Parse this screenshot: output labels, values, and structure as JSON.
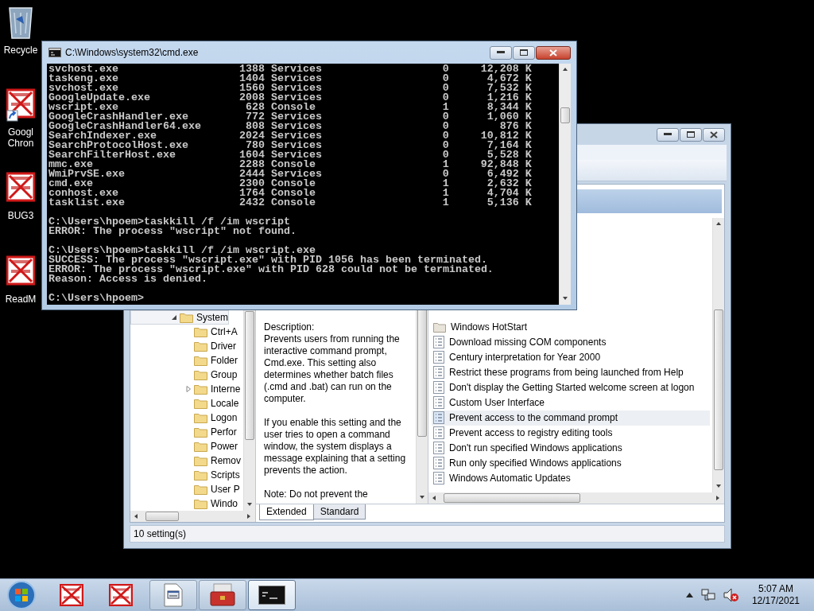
{
  "desktop_icons": [
    {
      "kind": "recycle_bin",
      "label_lines": [
        "Recycle"
      ]
    },
    {
      "kind": "denied_shortcut",
      "label_lines": [
        "Googl",
        "Chron"
      ]
    },
    {
      "kind": "denied",
      "label_lines": [
        "BUG3"
      ]
    },
    {
      "kind": "denied",
      "label_lines": [
        "ReadM"
      ]
    }
  ],
  "cmd_window": {
    "title": "C:\\Windows\\system32\\cmd.exe",
    "processes": [
      {
        "name": "svchost.exe",
        "pid": "1388",
        "session": "Services",
        "session_no": "0",
        "mem": "12,208 K"
      },
      {
        "name": "taskeng.exe",
        "pid": "1404",
        "session": "Services",
        "session_no": "0",
        "mem": "4,672 K"
      },
      {
        "name": "svchost.exe",
        "pid": "1560",
        "session": "Services",
        "session_no": "0",
        "mem": "7,532 K"
      },
      {
        "name": "GoogleUpdate.exe",
        "pid": "2008",
        "session": "Services",
        "session_no": "0",
        "mem": "1,216 K"
      },
      {
        "name": "wscript.exe",
        "pid": "628",
        "session": "Console",
        "session_no": "1",
        "mem": "8,344 K"
      },
      {
        "name": "GoogleCrashHandler.exe",
        "pid": "772",
        "session": "Services",
        "session_no": "0",
        "mem": "1,060 K"
      },
      {
        "name": "GoogleCrashHandler64.exe",
        "pid": "808",
        "session": "Services",
        "session_no": "0",
        "mem": "876 K"
      },
      {
        "name": "SearchIndexer.exe",
        "pid": "2024",
        "session": "Services",
        "session_no": "0",
        "mem": "10,812 K"
      },
      {
        "name": "SearchProtocolHost.exe",
        "pid": "780",
        "session": "Services",
        "session_no": "0",
        "mem": "7,164 K"
      },
      {
        "name": "SearchFilterHost.exe",
        "pid": "1604",
        "session": "Services",
        "session_no": "0",
        "mem": "5,528 K"
      },
      {
        "name": "mmc.exe",
        "pid": "2288",
        "session": "Console",
        "session_no": "1",
        "mem": "92,848 K"
      },
      {
        "name": "WmiPrvSE.exe",
        "pid": "2444",
        "session": "Services",
        "session_no": "0",
        "mem": "6,492 K"
      },
      {
        "name": "cmd.exe",
        "pid": "2300",
        "session": "Console",
        "session_no": "1",
        "mem": "2,632 K"
      },
      {
        "name": "conhost.exe",
        "pid": "1764",
        "session": "Console",
        "session_no": "1",
        "mem": "4,704 K"
      },
      {
        "name": "tasklist.exe",
        "pid": "2432",
        "session": "Console",
        "session_no": "1",
        "mem": "5,136 K"
      }
    ],
    "output_blocks": [
      [
        "C:\\Users\\hpoem>taskkill /f /im wscript",
        "ERROR: The process \"wscript\" not found."
      ],
      [
        "C:\\Users\\hpoem>taskkill /f /im wscript.exe",
        "SUCCESS: The process \"wscript.exe\" with PID 1056 has been terminated.",
        "ERROR: The process \"wscript.exe\" with PID 628 could not be terminated.",
        "Reason: Access is denied."
      ],
      [
        "C:\\Users\\hpoem>"
      ]
    ]
  },
  "policy_window": {
    "tree": {
      "label": "System",
      "expanded": true,
      "selected": true,
      "children": [
        {
          "label": "Ctrl+A",
          "expandable": false,
          "selected": false
        },
        {
          "label": "Driver",
          "expandable": false,
          "selected": false
        },
        {
          "label": "Folder",
          "expandable": false,
          "selected": false
        },
        {
          "label": "Group",
          "expandable": false,
          "selected": false
        },
        {
          "label": "Interne",
          "expandable": true,
          "selected": false
        },
        {
          "label": "Locale",
          "expandable": false,
          "selected": false
        },
        {
          "label": "Logon",
          "expandable": false,
          "selected": false
        },
        {
          "label": "Perfor",
          "expandable": false,
          "selected": false
        },
        {
          "label": "Power",
          "expandable": false,
          "selected": false
        },
        {
          "label": "Remov",
          "expandable": false,
          "selected": false
        },
        {
          "label": "Scripts",
          "expandable": false,
          "selected": false
        },
        {
          "label": "User P",
          "expandable": false,
          "selected": false
        },
        {
          "label": "Windo",
          "expandable": false,
          "selected": false
        }
      ]
    },
    "description": {
      "heading": "Description:",
      "paragraphs": [
        "Prevents users from running the interactive command prompt, Cmd.exe. This setting also determines whether batch files (.cmd and .bat) can run on the computer.",
        "If you enable this setting and the user tries to open a command window, the system displays a message explaining that a setting prevents the action.",
        "Note: Do not prevent the"
      ]
    },
    "settings": [
      {
        "kind": "folder",
        "label": "Windows HotStart",
        "selected": false
      },
      {
        "kind": "setting",
        "label": "Download missing COM components",
        "selected": false
      },
      {
        "kind": "setting",
        "label": "Century interpretation for Year 2000",
        "selected": false
      },
      {
        "kind": "setting",
        "label": "Restrict these programs from being launched from Help",
        "selected": false
      },
      {
        "kind": "setting",
        "label": "Don't display the Getting Started welcome screen at logon",
        "selected": false
      },
      {
        "kind": "setting",
        "label": "Custom User Interface",
        "selected": false
      },
      {
        "kind": "setting",
        "label": "Prevent access to the command prompt",
        "selected": true
      },
      {
        "kind": "setting",
        "label": "Prevent access to registry editing tools",
        "selected": false
      },
      {
        "kind": "setting",
        "label": "Don't run specified Windows applications",
        "selected": false
      },
      {
        "kind": "setting",
        "label": "Run only specified Windows applications",
        "selected": false
      },
      {
        "kind": "setting",
        "label": "Windows Automatic Updates",
        "selected": false
      }
    ],
    "tabs": [
      {
        "label": "Extended",
        "selected": true
      },
      {
        "label": "Standard",
        "selected": false
      }
    ],
    "status_bar": "10 setting(s)"
  },
  "taskbar": {
    "items": [
      {
        "kind": "denied",
        "active": false
      },
      {
        "kind": "denied",
        "active": false
      },
      {
        "kind": "document",
        "active": false
      },
      {
        "kind": "toolbox",
        "active": false
      },
      {
        "kind": "console",
        "active": true
      }
    ],
    "clock": {
      "time": "5:07 AM",
      "date": "12/17/2021"
    }
  }
}
